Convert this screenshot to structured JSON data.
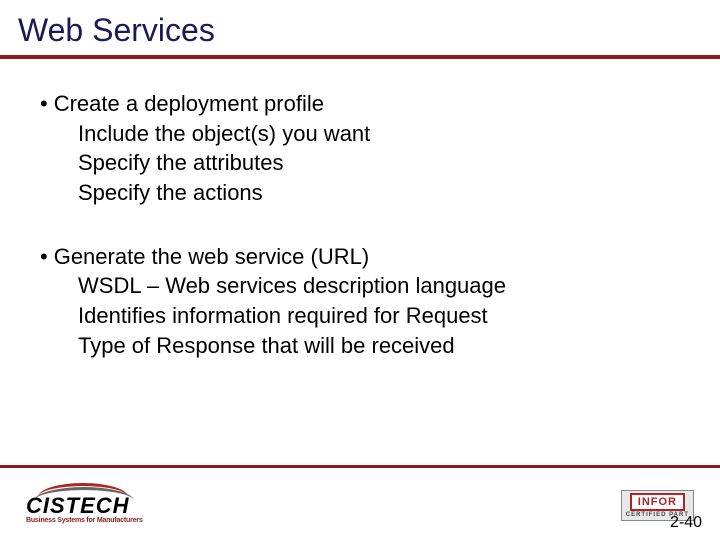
{
  "title": "Web Services",
  "bullets": [
    {
      "head": "Create a deployment profile",
      "subs": [
        "Include the object(s) you want",
        "Specify the attributes",
        "Specify the actions"
      ]
    },
    {
      "head": "Generate the web service (URL)",
      "subs": [
        "WSDL – Web services description language",
        "Identifies information required for Request",
        "Type of Response that will be received"
      ]
    }
  ],
  "footer": {
    "cistech_name": "CISTECH",
    "cistech_tagline": "Business Systems for Manufacturers",
    "infor_name": "INFOR",
    "infor_sub": "CERTIFIED PART",
    "page": "2-40"
  }
}
